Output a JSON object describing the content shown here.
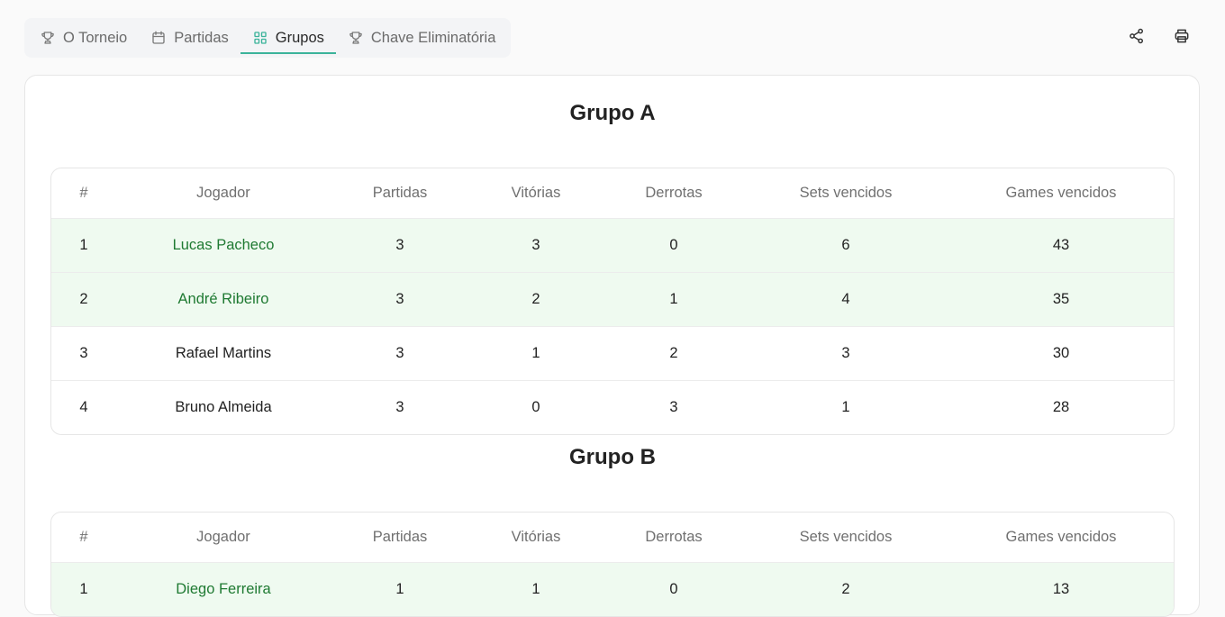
{
  "nav": {
    "tabs": [
      {
        "label": "O Torneio",
        "icon": "trophy-icon"
      },
      {
        "label": "Partidas",
        "icon": "calendar-icon"
      },
      {
        "label": "Grupos",
        "icon": "grid-icon",
        "active": true
      },
      {
        "label": "Chave Eliminatória",
        "icon": "trophy-icon"
      }
    ],
    "actions": [
      "share-icon",
      "printer-icon"
    ]
  },
  "accent_color": "#3bb39a",
  "qualified_bg": "#effaf0",
  "qualified_text": "#1f7a32",
  "columns": [
    "#",
    "Jogador",
    "Partidas",
    "Vitórias",
    "Derrotas",
    "Sets vencidos",
    "Games vencidos"
  ],
  "groups": [
    {
      "title": "Grupo A",
      "rows": [
        {
          "pos": "1",
          "player": "Lucas Pacheco",
          "partidas": "3",
          "vitorias": "3",
          "derrotas": "0",
          "sets": "6",
          "games": "43",
          "qualified": true
        },
        {
          "pos": "2",
          "player": "André Ribeiro",
          "partidas": "3",
          "vitorias": "2",
          "derrotas": "1",
          "sets": "4",
          "games": "35",
          "qualified": true
        },
        {
          "pos": "3",
          "player": "Rafael Martins",
          "partidas": "3",
          "vitorias": "1",
          "derrotas": "2",
          "sets": "3",
          "games": "30",
          "qualified": false
        },
        {
          "pos": "4",
          "player": "Bruno Almeida",
          "partidas": "3",
          "vitorias": "0",
          "derrotas": "3",
          "sets": "1",
          "games": "28",
          "qualified": false
        }
      ]
    },
    {
      "title": "Grupo B",
      "rows": [
        {
          "pos": "1",
          "player": "Diego Ferreira",
          "partidas": "1",
          "vitorias": "1",
          "derrotas": "0",
          "sets": "2",
          "games": "13",
          "qualified": true
        }
      ]
    }
  ]
}
